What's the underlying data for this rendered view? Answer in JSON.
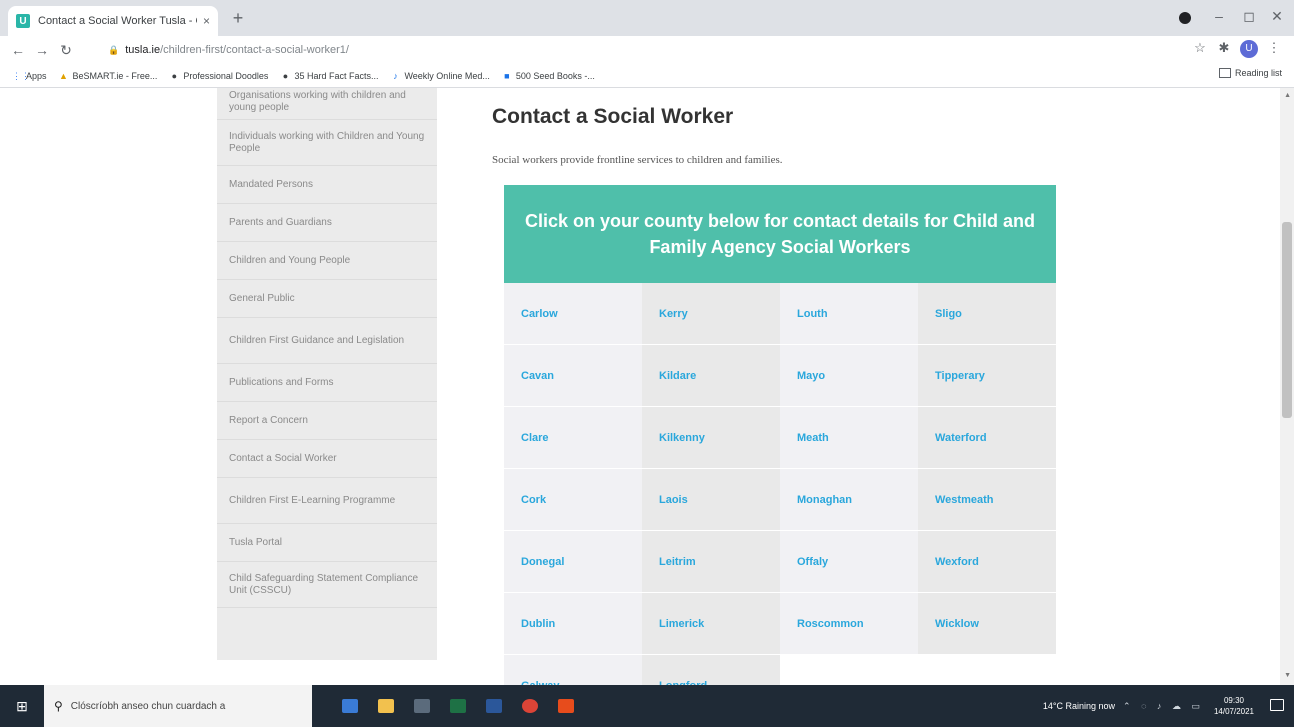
{
  "browser": {
    "tab_title": "Contact a Social Worker Tusla - C",
    "tab_close": "×",
    "new_tab": "+",
    "url_host": "tusla.ie",
    "url_path": "/children-first/contact-a-social-worker1/",
    "bookmarks": [
      {
        "icon": "apps-grid-icon",
        "label": "Apps"
      },
      {
        "icon": "bookmark-icon",
        "label": "BeSMART.ie - Free..."
      },
      {
        "icon": "bookmark-icon",
        "label": "Professional Doodles"
      },
      {
        "icon": "bookmark-icon",
        "label": "35 Hard Fact Facts..."
      },
      {
        "icon": "bookmark-icon",
        "label": "Weekly Online Med..."
      },
      {
        "icon": "bookmark-icon",
        "label": "500 Seed Books -..."
      }
    ],
    "reading_list": "Reading list",
    "avatar_letter": "U"
  },
  "sidebar": {
    "items": [
      "Organisations working with children and young people",
      "Individuals working with Children and Young People",
      "Mandated Persons",
      "Parents and Guardians",
      "Children and Young People",
      "General Public",
      "Children First Guidance and Legislation",
      "Publications and Forms",
      "Report a Concern",
      "Contact a Social Worker",
      "Children First E-Learning Programme",
      "Tusla Portal",
      "Child Safeguarding Statement Compliance Unit (CSSCU)"
    ]
  },
  "main": {
    "title": "Contact a Social Worker",
    "intro": "Social workers provide frontline services to children and families.",
    "banner": "Click on your county below for contact details for Child and Family Agency Social Workers",
    "counties": [
      [
        "Carlow",
        "Cavan",
        "Clare",
        "Cork",
        "Donegal",
        "Dublin",
        "Galway"
      ],
      [
        "Kerry",
        "Kildare",
        "Kilkenny",
        "Laois",
        "Leitrim",
        "Limerick",
        "Longford"
      ],
      [
        "Louth",
        "Mayo",
        "Meath",
        "Monaghan",
        "Offaly",
        "Roscommon"
      ],
      [
        "Sligo",
        "Tipperary",
        "Waterford",
        "Westmeath",
        "Wexford",
        "Wicklow"
      ]
    ]
  },
  "taskbar": {
    "search_placeholder": "Clóscríobh anseo chun cuardach a",
    "weather": "14°C  Raining now",
    "time": "09:30",
    "date": "14/07/2021"
  },
  "colors": {
    "banner_bg": "#4fbfaa",
    "link": "#2aa7dc",
    "sidebar_bg": "#ebebeb"
  }
}
